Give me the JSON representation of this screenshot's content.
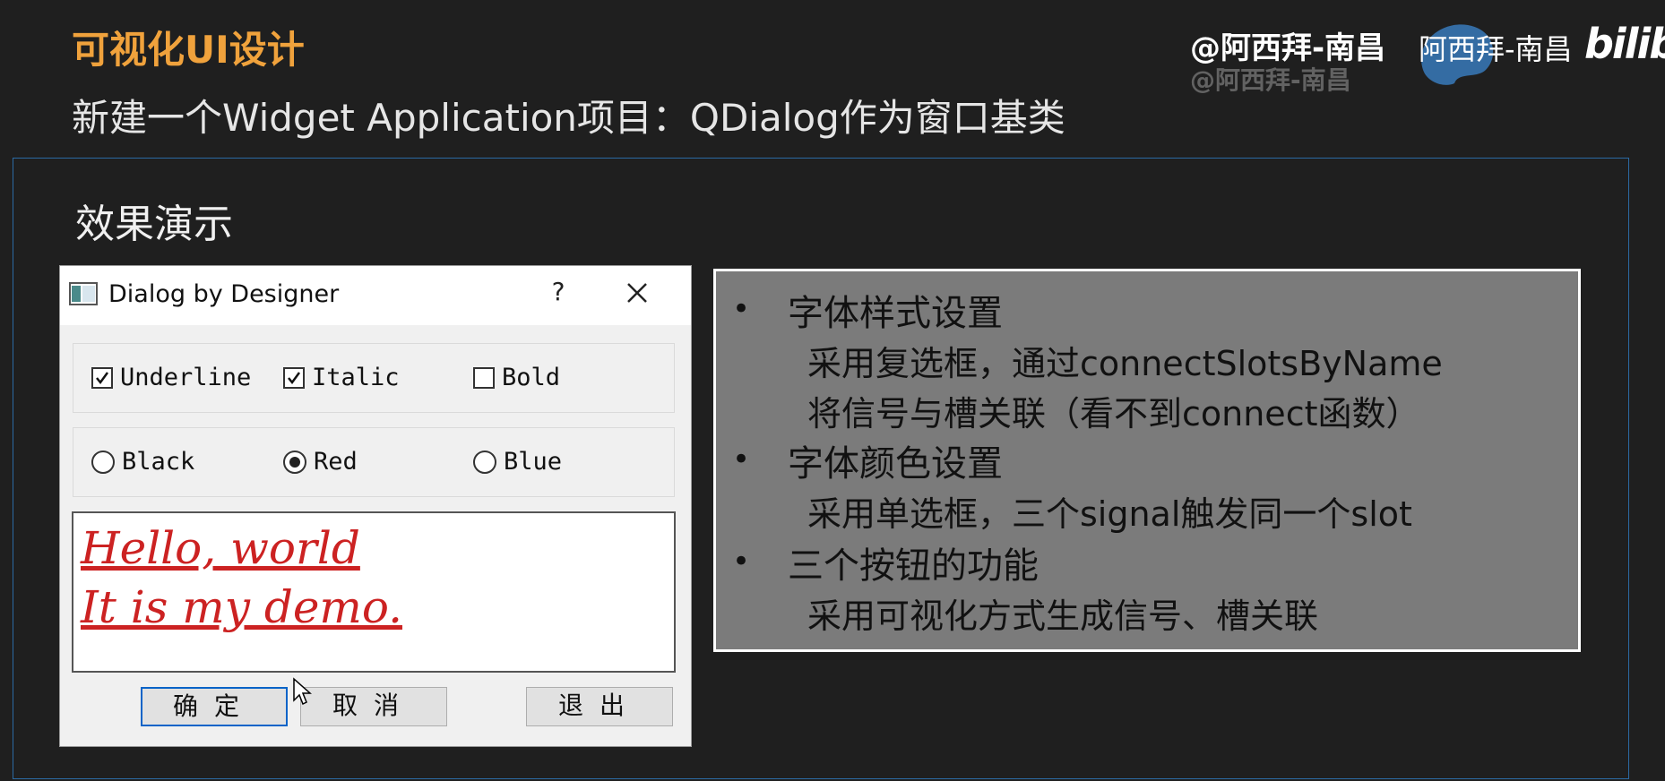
{
  "slide": {
    "title": "可视化UI设计",
    "subtitle": "新建一个Widget Application项目：QDialog作为窗口基类",
    "section_heading": "效果演示"
  },
  "watermark": {
    "user": "@阿西拜-南昌",
    "name": "阿西拜-南昌",
    "logo": "bilibi"
  },
  "dialog": {
    "title": "Dialog by Designer",
    "help_label": "?",
    "checkboxes": [
      {
        "label": "Underline",
        "checked": true
      },
      {
        "label": "Italic",
        "checked": true
      },
      {
        "label": "Bold",
        "checked": false
      }
    ],
    "radios": [
      {
        "label": "Black",
        "selected": false
      },
      {
        "label": "Red",
        "selected": true
      },
      {
        "label": "Blue",
        "selected": false
      }
    ],
    "text_lines": [
      "Hello, world",
      "It is my demo."
    ],
    "text_color": "#cc2222",
    "buttons": {
      "ok": "确定",
      "cancel": "取消",
      "exit": "退出"
    }
  },
  "notes": {
    "items": [
      {
        "heading": "字体样式设置",
        "lines": [
          "采用复选框，通过connectSlotsByName",
          "将信号与槽关联（看不到connect函数）"
        ]
      },
      {
        "heading": "字体颜色设置",
        "lines": [
          "采用单选框，三个signal触发同一个slot"
        ]
      },
      {
        "heading": "三个按钮的功能",
        "lines": [
          "采用可视化方式生成信号、槽关联"
        ]
      }
    ],
    "bullet": "•"
  },
  "colors": {
    "title_accent": "#f0a23c",
    "background": "#1f1f1f",
    "frame_border": "#2b6aa3",
    "notes_bg": "#7b7b7b",
    "default_button_border": "#0a64c8"
  }
}
